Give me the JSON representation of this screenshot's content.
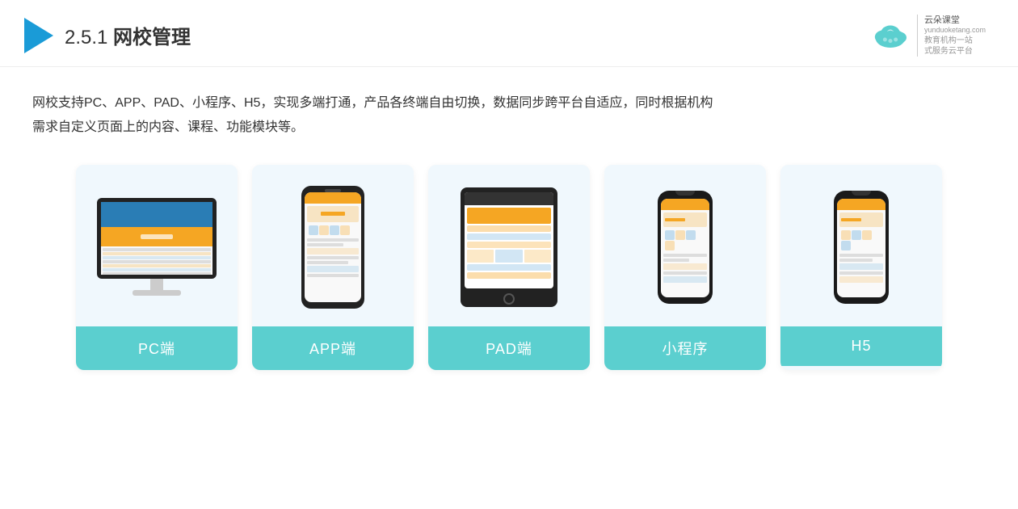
{
  "header": {
    "section_number": "2.5.1",
    "title_prefix": "2.5.1 ",
    "title_bold": "网校管理",
    "arrow_color": "#1a9bd7"
  },
  "brand": {
    "logo_text": "云朵课堂",
    "logo_sub1": "教育机构一站",
    "logo_sub2": "式服务云平台",
    "site": "yunduoketang.com"
  },
  "description": {
    "text_line1": "网校支持PC、APP、PAD、小程序、H5，实现多端打通，产品各终端自由切换，数据同步跨平台自适应，同时根据机构",
    "text_line2": "需求自定义页面上的内容、课程、功能模块等。"
  },
  "cards": [
    {
      "id": "pc",
      "label": "PC端",
      "device": "pc"
    },
    {
      "id": "app",
      "label": "APP端",
      "device": "phone"
    },
    {
      "id": "pad",
      "label": "PAD端",
      "device": "tablet"
    },
    {
      "id": "miniprogram",
      "label": "小程序",
      "device": "phone-small"
    },
    {
      "id": "h5",
      "label": "H5",
      "device": "phone-small2"
    }
  ],
  "colors": {
    "card_label_bg": "#5bcfcf",
    "card_bg": "#eef6fb",
    "accent_orange": "#f5a623",
    "accent_blue": "#2a7db5",
    "text_dark": "#333333"
  }
}
